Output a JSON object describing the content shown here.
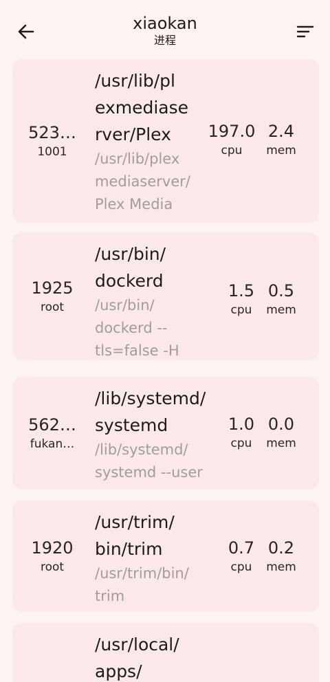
{
  "header": {
    "title": "xiaokan",
    "subtitle": "进程",
    "back_icon": "arrow-left-icon",
    "sort_icon": "sort-lines-icon"
  },
  "processes": [
    {
      "pid": "523…",
      "user": "1001",
      "cmd_lines": [
        "/usr/lib/pl",
        "exmediase",
        "rver/Plex"
      ],
      "full_lines": [
        "/usr/lib/plex",
        "mediaserver/",
        "Plex Media"
      ],
      "cpu": "197.0",
      "cpu_label": "cpu",
      "mem": "2.4",
      "mem_label": "mem"
    },
    {
      "pid": "1925",
      "user": "root",
      "cmd_lines": [
        "/usr/bin/",
        "dockerd"
      ],
      "full_lines": [
        "/usr/bin/",
        "dockerd --",
        "tls=false -H"
      ],
      "cpu": "1.5",
      "cpu_label": "cpu",
      "mem": "0.5",
      "mem_label": "mem"
    },
    {
      "pid": "562…",
      "user": "fukan…",
      "cmd_lines": [
        "/lib/systemd/",
        "systemd"
      ],
      "full_lines": [
        "/lib/systemd/",
        "systemd --user"
      ],
      "cpu": "1.0",
      "cpu_label": "cpu",
      "mem": "0.0",
      "mem_label": "mem"
    },
    {
      "pid": "1920",
      "user": "root",
      "cmd_lines": [
        "/usr/trim/",
        "bin/trim"
      ],
      "full_lines": [
        "/usr/trim/bin/",
        "trim"
      ],
      "cpu": "0.7",
      "cpu_label": "cpu",
      "mem": "0.2",
      "mem_label": "mem"
    },
    {
      "pid": "",
      "user": "",
      "cmd_lines": [
        "/usr/local/",
        "apps/"
      ],
      "full_lines": [],
      "cpu": "",
      "cpu_label": "",
      "mem": "",
      "mem_label": ""
    }
  ],
  "colors": {
    "background": "#fdf3f3",
    "card": "#fbe8e9",
    "text": "#1e1a1a",
    "muted": "#a39c9c"
  }
}
